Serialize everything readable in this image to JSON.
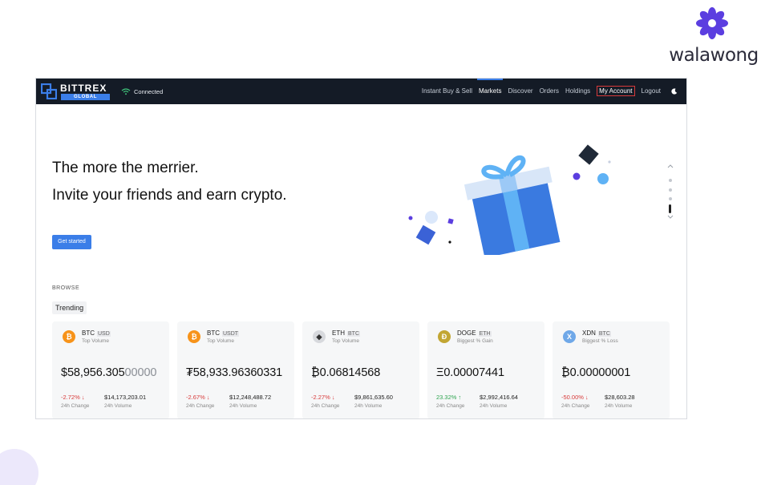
{
  "watermark": {
    "brand": "walawong"
  },
  "topbar": {
    "logo": {
      "name": "BITTREX",
      "tag": "GLOBAL"
    },
    "connection": "Connected",
    "nav": [
      "Instant Buy & Sell",
      "Markets",
      "Discover",
      "Orders",
      "Holdings",
      "My Account",
      "Logout"
    ],
    "active_nav": "Markets",
    "highlighted_nav": "My Account"
  },
  "hero": {
    "title": "The more the merrier.",
    "subtitle": "Invite your friends and earn crypto.",
    "cta": "Get started"
  },
  "browse": {
    "heading": "BROWSE",
    "tab": "Trending",
    "cards": [
      {
        "base": "BTC",
        "quote": "USD",
        "tag": "Top Volume",
        "price_main": "$58,956.305",
        "price_dim": "00000",
        "change": "-2.72% ↓",
        "change_dir": "neg",
        "volume": "$14,173,203.01",
        "change_label": "24h Change",
        "volume_label": "24h Volume",
        "icon": "bitcoin-icon",
        "icon_color": "#f7931a"
      },
      {
        "base": "BTC",
        "quote": "USDT",
        "tag": "Top Volume",
        "price_main": "₮58,933.96360331",
        "price_dim": "",
        "change": "-2.67% ↓",
        "change_dir": "neg",
        "volume": "$12,248,488.72",
        "change_label": "24h Change",
        "volume_label": "24h Volume",
        "icon": "bitcoin-icon",
        "icon_color": "#f7931a"
      },
      {
        "base": "ETH",
        "quote": "BTC",
        "tag": "Top Volume",
        "price_main": "₿0.06814568",
        "price_dim": "",
        "change": "-2.27% ↓",
        "change_dir": "neg",
        "volume": "$9,861,635.60",
        "change_label": "24h Change",
        "volume_label": "24h Volume",
        "icon": "ethereum-icon",
        "icon_color": "#d7d9dd"
      },
      {
        "base": "DOGE",
        "quote": "ETH",
        "tag": "Biggest % Gain",
        "price_main": "Ξ0.00007441",
        "price_dim": "",
        "change": "23.32% ↑",
        "change_dir": "pos",
        "volume": "$2,992,416.64",
        "change_label": "24h Change",
        "volume_label": "24h Volume",
        "icon": "dogecoin-icon",
        "icon_color": "#c2a633"
      },
      {
        "base": "XDN",
        "quote": "BTC",
        "tag": "Biggest % Loss",
        "price_main": "₿0.00000001",
        "price_dim": "",
        "change": "-50.00% ↓",
        "change_dir": "neg",
        "volume": "$28,603.28",
        "change_label": "24h Change",
        "volume_label": "24h Volume",
        "icon": "digitalnote-icon",
        "icon_color": "#6fa8e8"
      }
    ]
  },
  "colors": {
    "accent": "#3b7ee8",
    "topbar": "#141b26",
    "negative": "#d83a3a",
    "positive": "#2ea44f",
    "brand_purple": "#5b3ee0"
  }
}
